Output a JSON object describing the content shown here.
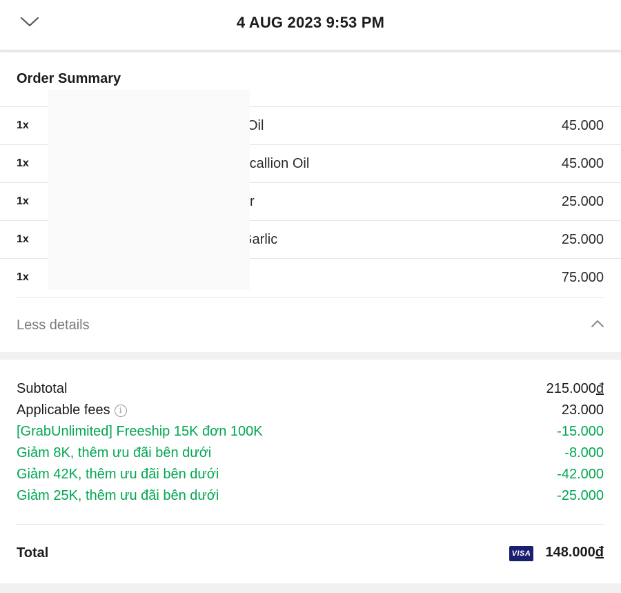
{
  "header": {
    "title": "4 AUG 2023 9:53 PM",
    "back_icon": "chevron-down-icon"
  },
  "order_summary": {
    "title": "Order Summary",
    "items": [
      {
        "qty": "1x",
        "name": "Oil",
        "price": "45.000"
      },
      {
        "qty": "1x",
        "name": "th Scallion Oil",
        "price": "45.000"
      },
      {
        "qty": "1x",
        "name": "r",
        "price": "25.000"
      },
      {
        "qty": "1x",
        "name": "Garlic",
        "price": "25.000"
      },
      {
        "qty": "1x",
        "name": "",
        "price": "75.000"
      }
    ],
    "less_details": "Less details"
  },
  "totals": {
    "subtotal_label": "Subtotal",
    "subtotal_value": "215.000",
    "fees_label": "Applicable fees",
    "fees_value": "23.000",
    "promos": [
      {
        "label": "[GrabUnlimited] Freeship 15K đơn 100K",
        "value": "-15.000"
      },
      {
        "label": "Giảm 8K, thêm ưu đãi bên dưới",
        "value": "-8.000"
      },
      {
        "label": "Giảm 42K, thêm ưu đãi bên dưới",
        "value": "-42.000"
      },
      {
        "label": "Giảm 25K, thêm ưu đãi bên dưới",
        "value": "-25.000"
      }
    ],
    "total_label": "Total",
    "total_value": "148.000",
    "currency_symbol": "đ",
    "payment_badge": "VISA"
  },
  "colors": {
    "promo_green": "#00a651",
    "visa_blue": "#1a1f71"
  }
}
